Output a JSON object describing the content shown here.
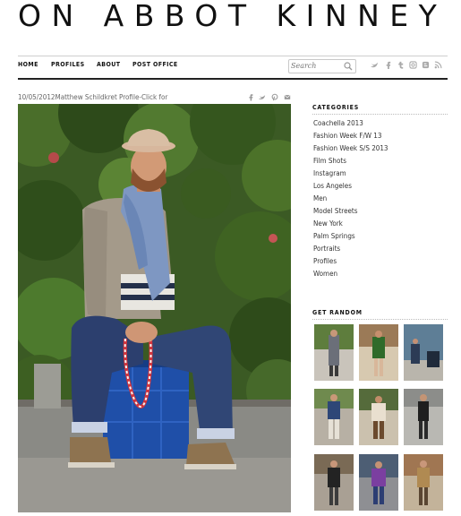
{
  "site": {
    "title": "ON ABBOT KINNEY"
  },
  "nav": {
    "items": [
      {
        "label": "HOME"
      },
      {
        "label": "PROFILES"
      },
      {
        "label": "ABOUT"
      },
      {
        "label": "POST OFFICE"
      }
    ],
    "search_placeholder": "Search",
    "social_icons": [
      "twitter-icon",
      "facebook-icon",
      "tumblr-icon",
      "instagram-icon",
      "blogger-icon",
      "rss-icon"
    ]
  },
  "post": {
    "meta": "10/05/2012Matthew Schildkret Profile-Click for",
    "share_icons": [
      "facebook-icon",
      "twitter-icon",
      "pinterest-icon",
      "email-icon"
    ]
  },
  "sidebar": {
    "categories_title": "CATEGORIES",
    "categories": [
      "Coachella 2013",
      "Fashion Week F/W 13",
      "Fashion Week S/S 2013",
      "Film Shots",
      "Instagram",
      "Los Angeles",
      "Men",
      "Model Streets",
      "New York",
      "Palm Springs",
      "Portraits",
      "Profiles",
      "Women"
    ],
    "random_title": "GET RANDOM"
  },
  "colors": {
    "accent": "#111111",
    "foliage": "#2f4a1e",
    "crate": "#1f4fa8"
  }
}
